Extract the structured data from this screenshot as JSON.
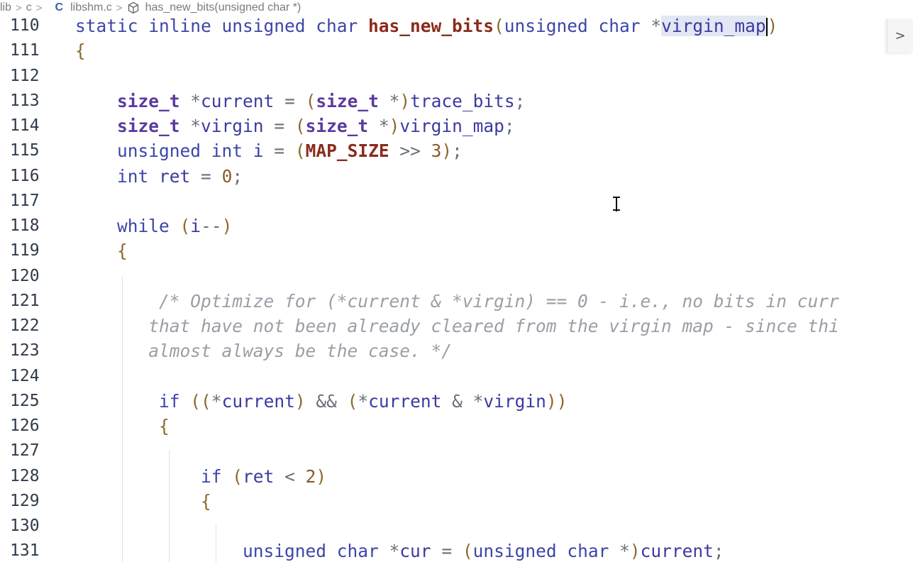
{
  "breadcrumb": {
    "items": [
      "lib",
      "c",
      "libshm.c",
      "has_new_bits(unsigned char *)"
    ],
    "separator": ">",
    "file_type_icon": "C",
    "symbol_icon": "cube-icon"
  },
  "sidebar_toggle": {
    "glyph": ">"
  },
  "colors": {
    "keyword": "#3b46a8",
    "type_bold": "#5a3a9e",
    "function_name": "#8a2b1c",
    "comment": "#9a9ea6",
    "line_number": "#2f3b4a",
    "selection_highlight": "#e3e6f3"
  },
  "lines": [
    {
      "n": "110",
      "tokens": [
        [
          "kw",
          "static inline unsigned char "
        ],
        [
          "fn",
          "has_new_bits"
        ],
        [
          "br",
          "("
        ],
        [
          "kw",
          "unsigned char "
        ],
        [
          "op",
          "*"
        ],
        [
          "hl",
          "virgin_map"
        ],
        [
          "caret",
          ""
        ],
        [
          "br",
          ")"
        ]
      ]
    },
    {
      "n": "111",
      "tokens": [
        [
          "br",
          "{"
        ]
      ]
    },
    {
      "n": "112",
      "tokens": []
    },
    {
      "n": "113",
      "tokens": [
        [
          "sp",
          "    "
        ],
        [
          "tp",
          "size_t"
        ],
        [
          "op",
          " *"
        ],
        [
          "id",
          "current "
        ],
        [
          "op",
          "= "
        ],
        [
          "br",
          "("
        ],
        [
          "tp",
          "size_t"
        ],
        [
          "op",
          " *"
        ],
        [
          "br",
          ")"
        ],
        [
          "id",
          "trace_bits"
        ],
        [
          "op",
          ";"
        ]
      ]
    },
    {
      "n": "114",
      "tokens": [
        [
          "sp",
          "    "
        ],
        [
          "tp",
          "size_t"
        ],
        [
          "op",
          " *"
        ],
        [
          "id",
          "virgin "
        ],
        [
          "op",
          "= "
        ],
        [
          "br",
          "("
        ],
        [
          "tp",
          "size_t"
        ],
        [
          "op",
          " *"
        ],
        [
          "br",
          ")"
        ],
        [
          "id",
          "virgin_map"
        ],
        [
          "op",
          ";"
        ]
      ]
    },
    {
      "n": "115",
      "tokens": [
        [
          "sp",
          "    "
        ],
        [
          "kw",
          "unsigned int "
        ],
        [
          "id",
          "i "
        ],
        [
          "op",
          "= "
        ],
        [
          "br",
          "("
        ],
        [
          "mac",
          "MAP_SIZE"
        ],
        [
          "op",
          " >> "
        ],
        [
          "num",
          "3"
        ],
        [
          "br",
          ")"
        ],
        [
          "op",
          ";"
        ]
      ]
    },
    {
      "n": "116",
      "tokens": [
        [
          "sp",
          "    "
        ],
        [
          "kw",
          "int "
        ],
        [
          "id",
          "ret "
        ],
        [
          "op",
          "= "
        ],
        [
          "num",
          "0"
        ],
        [
          "op",
          ";"
        ]
      ]
    },
    {
      "n": "117",
      "tokens": []
    },
    {
      "n": "118",
      "tokens": [
        [
          "sp",
          "    "
        ],
        [
          "kw",
          "while "
        ],
        [
          "br",
          "("
        ],
        [
          "id",
          "i"
        ],
        [
          "op",
          "--"
        ],
        [
          "br",
          ")"
        ]
      ]
    },
    {
      "n": "119",
      "tokens": [
        [
          "sp",
          "    "
        ],
        [
          "br",
          "{"
        ]
      ]
    },
    {
      "n": "120",
      "tokens": []
    },
    {
      "n": "121",
      "tokens": [
        [
          "sp",
          "        "
        ],
        [
          "cm",
          "/* Optimize for (*current & *virgin) == 0 - i.e., no bits in curr"
        ]
      ]
    },
    {
      "n": "122",
      "tokens": [
        [
          "sp",
          "       "
        ],
        [
          "cm",
          "that have not been already cleared from the virgin map - since thi"
        ]
      ]
    },
    {
      "n": "123",
      "tokens": [
        [
          "sp",
          "       "
        ],
        [
          "cm",
          "almost always be the case. */"
        ]
      ]
    },
    {
      "n": "124",
      "tokens": []
    },
    {
      "n": "125",
      "tokens": [
        [
          "sp",
          "        "
        ],
        [
          "kw",
          "if "
        ],
        [
          "br",
          "(("
        ],
        [
          "op",
          "*"
        ],
        [
          "id",
          "current"
        ],
        [
          "br",
          ")"
        ],
        [
          "op",
          " && "
        ],
        [
          "br",
          "("
        ],
        [
          "op",
          "*"
        ],
        [
          "id",
          "current "
        ],
        [
          "op",
          "& *"
        ],
        [
          "id",
          "virgin"
        ],
        [
          "br",
          "))"
        ]
      ]
    },
    {
      "n": "126",
      "tokens": [
        [
          "sp",
          "        "
        ],
        [
          "br",
          "{"
        ]
      ]
    },
    {
      "n": "127",
      "tokens": []
    },
    {
      "n": "128",
      "tokens": [
        [
          "sp",
          "            "
        ],
        [
          "kw",
          "if "
        ],
        [
          "br",
          "("
        ],
        [
          "id",
          "ret "
        ],
        [
          "op",
          "< "
        ],
        [
          "num",
          "2"
        ],
        [
          "br",
          ")"
        ]
      ]
    },
    {
      "n": "129",
      "tokens": [
        [
          "sp",
          "            "
        ],
        [
          "br",
          "{"
        ]
      ]
    },
    {
      "n": "130",
      "tokens": []
    },
    {
      "n": "131",
      "tokens": [
        [
          "sp",
          "                "
        ],
        [
          "kw",
          "unsigned char "
        ],
        [
          "op",
          "*"
        ],
        [
          "id",
          "cur "
        ],
        [
          "op",
          "= "
        ],
        [
          "br",
          "("
        ],
        [
          "kw",
          "unsigned char "
        ],
        [
          "op",
          "*"
        ],
        [
          "br",
          ")"
        ],
        [
          "id",
          "current"
        ],
        [
          "op",
          ";"
        ]
      ]
    }
  ]
}
